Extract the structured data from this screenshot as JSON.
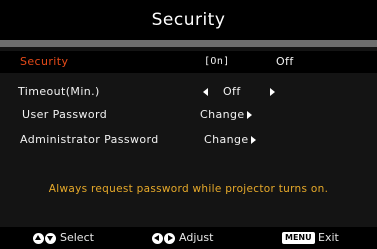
{
  "header": {
    "title": "Security"
  },
  "menu": {
    "security": {
      "label": "Security",
      "option_on": "[On]",
      "option_off": "Off"
    },
    "timeout": {
      "label": "Timeout(Min.)",
      "value": "Off"
    },
    "user_password": {
      "label": "User Password",
      "action": "Change"
    },
    "admin_password": {
      "label": "Administrator Password",
      "action": "Change"
    }
  },
  "notice": "Always request password while projector turns on.",
  "footer": {
    "select_label": "Select",
    "adjust_label": "Adjust",
    "menu_key": "MENU",
    "exit_label": "Exit"
  },
  "colors": {
    "highlight": "#e64a19",
    "notice": "#e6a92a",
    "separator": "#6e6e6e",
    "background": "#141414"
  },
  "icons": [
    "up-circle-icon",
    "down-circle-icon",
    "left-circle-icon",
    "right-circle-icon",
    "left-arrow-icon",
    "right-arrow-icon"
  ]
}
